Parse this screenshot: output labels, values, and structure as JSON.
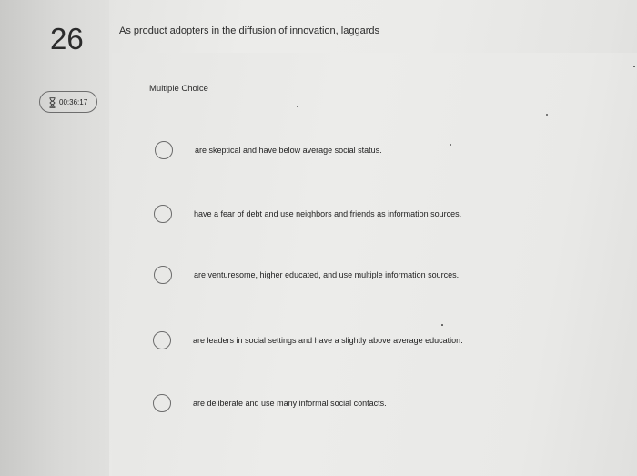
{
  "question": {
    "number": "26",
    "timer": "00:36:17",
    "prompt": "As product adopters in the diffusion of innovation, laggards",
    "type_label": "Multiple Choice"
  },
  "choices": [
    {
      "text": "are skeptical and have below average social status."
    },
    {
      "text": "have a fear of debt and use neighbors and friends as information sources."
    },
    {
      "text": "are venturesome, higher educated, and use multiple information sources."
    },
    {
      "text": "are leaders in social settings and have a slightly above average education."
    },
    {
      "text": "are deliberate and use many informal social contacts."
    }
  ],
  "icons": {
    "timer": "hourglass-icon",
    "choice": "radio-button"
  },
  "colors": {
    "background": "#ececea",
    "text": "#222222",
    "radio_border": "#6b6b6b"
  }
}
